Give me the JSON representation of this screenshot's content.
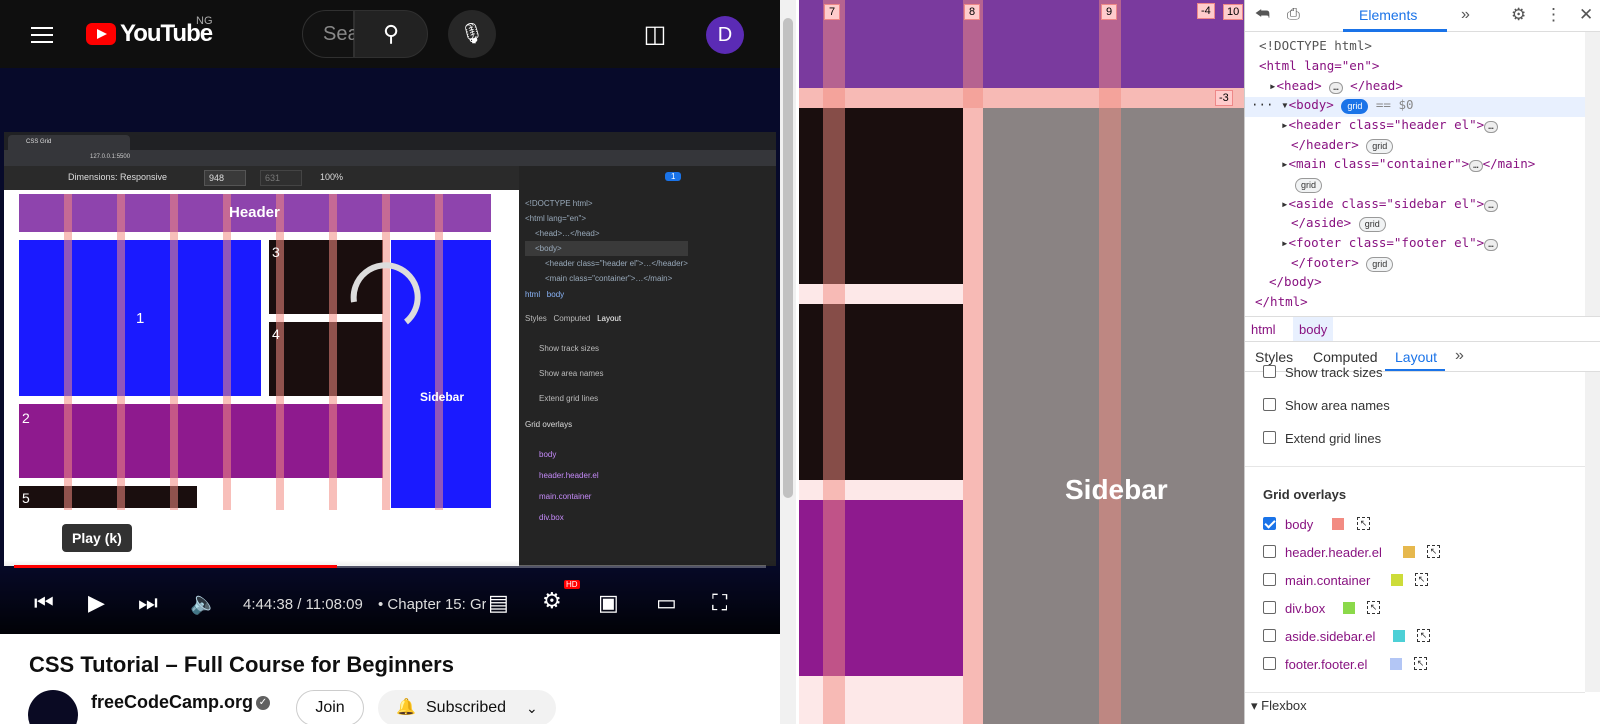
{
  "youtube": {
    "logo_text": "YouTube",
    "region": "NG",
    "search_placeholder": "Sea",
    "avatar_letter": "D",
    "icons": {
      "menu": "hamburger-icon",
      "search": "search-icon",
      "mic": "microphone-icon",
      "create": "create-video-icon"
    }
  },
  "inner_browser": {
    "tab_title": "CSS Grid",
    "address": "127.0.0.1:5500",
    "dimensions_label": "Dimensions: Responsive",
    "width": "948",
    "height": "631",
    "zoom": "100%",
    "grid_cells": {
      "header": "Header",
      "c1": "1",
      "c2": "2",
      "c3": "3",
      "c4": "4",
      "c5": "5",
      "sidebar": "Sidebar"
    },
    "dev_lines": [
      "<!DOCTYPE html>",
      "<html lang=\"en\">",
      "<head>…</head>",
      "<body>",
      "<header class=\"header el\">…</header>",
      "<main class=\"container\">…</main>"
    ],
    "dev_badge": "1",
    "crumbs": [
      "html",
      "body"
    ],
    "tabs": [
      "Styles",
      "Computed",
      "Layout"
    ],
    "options": [
      "Show track sizes",
      "Show area names",
      "Extend grid lines"
    ],
    "overlays_title": "Grid overlays",
    "overlays": [
      "body",
      "header.header.el",
      "main.container",
      "div.box"
    ]
  },
  "player": {
    "progress_pct": 43,
    "time": "4:44:38 / 11:08:09",
    "chapter": "• Chapter 15: Gr",
    "tooltip": "Play (k)",
    "hd_badge": "HD"
  },
  "video_info": {
    "title": "CSS Tutorial – Full Course for Beginners",
    "channel": "freeCodeCamp.org",
    "join": "Join",
    "subscribed": "Subscribed"
  },
  "preview": {
    "sidebar_label": "Sidebar",
    "line_numbers": [
      "7",
      "8",
      "9"
    ],
    "corner_numbers": [
      "-4",
      "10"
    ],
    "neg_number": "-3"
  },
  "devtools": {
    "tab": "Elements",
    "lines": {
      "doctype": "<!DOCTYPE html>",
      "html_open": "<html lang=\"en\">",
      "head": "<head>",
      "head_close": "</head>",
      "body": "<body>",
      "body_badge": "grid",
      "eq0": "== $0",
      "header_open": "<header class=\"header el\">",
      "header_close": "</header>",
      "main_open": "<main class=\"container\">",
      "main_close": "</main>",
      "aside_open": "<aside class=\"sidebar el\">",
      "aside_close": "</aside>",
      "footer_open": "<footer class=\"footer el\">",
      "footer_close": "</footer>",
      "body_close": "</body>",
      "html_close": "</html>",
      "grid_badge": "grid"
    },
    "crumbs": [
      "html",
      "body"
    ],
    "sub_tabs": [
      "Styles",
      "Computed",
      "Layout"
    ],
    "options": [
      {
        "label": "Show track sizes",
        "checked": false
      },
      {
        "label": "Show area names",
        "checked": false
      },
      {
        "label": "Extend grid lines",
        "checked": false
      }
    ],
    "overlays_title": "Grid overlays",
    "overlays": [
      {
        "label": "body",
        "checked": true,
        "color": "#f28b82"
      },
      {
        "label": "header.header.el",
        "checked": false,
        "color": "#e6b84d"
      },
      {
        "label": "main.container",
        "checked": false,
        "color": "#cddc39"
      },
      {
        "label": "div.box",
        "checked": false,
        "color": "#8bd94a"
      },
      {
        "label": "aside.sidebar.el",
        "checked": false,
        "color": "#4dd0d6"
      },
      {
        "label": "footer.footer.el",
        "checked": false,
        "color": "#b3c6f5"
      }
    ],
    "flexbox_title": "Flexbox"
  }
}
